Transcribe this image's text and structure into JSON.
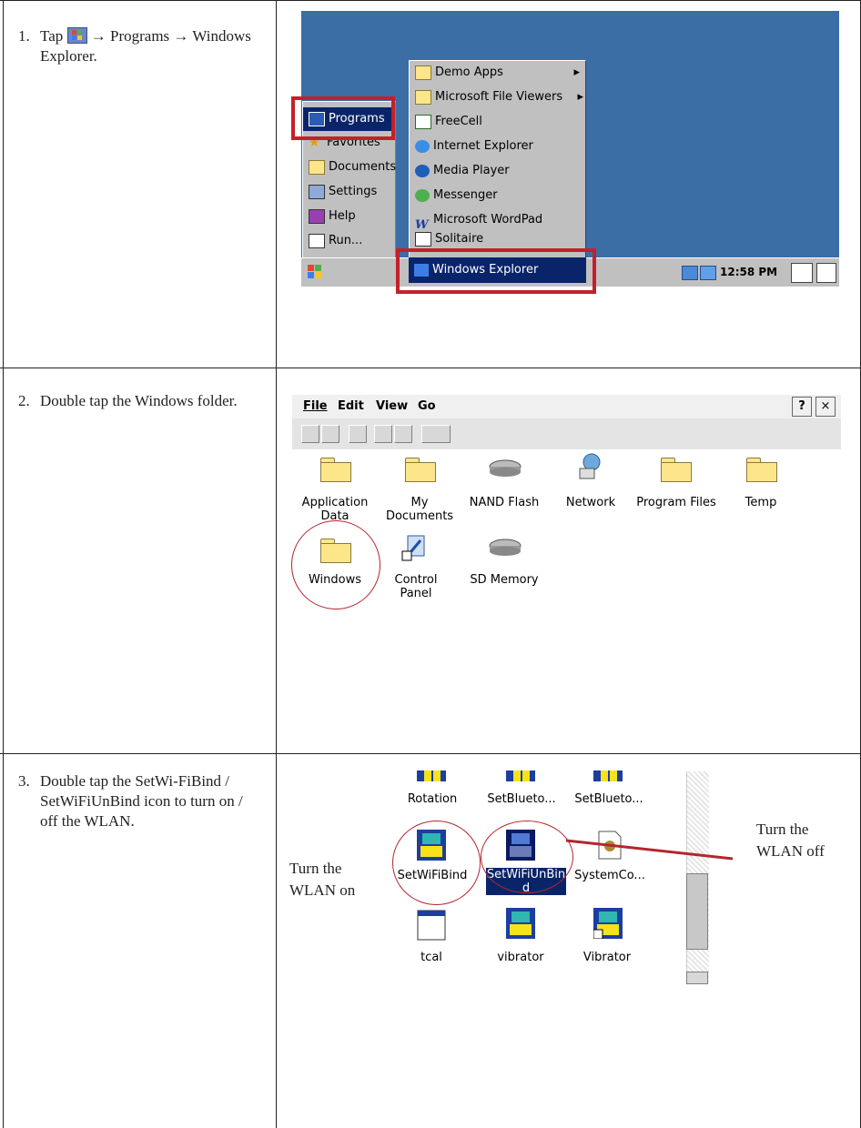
{
  "steps": [
    {
      "num": "1.",
      "text_pre": "Tap",
      "text_post": "→ Programs → Windows Explorer."
    },
    {
      "num": "2.",
      "text": "Double tap the Windows folder."
    },
    {
      "num": "3.",
      "text": "Double tap the SetWi-FiBind / SetWiFiUnBind icon to turn on / off the WLAN."
    }
  ],
  "start_menu": {
    "items": [
      "Programs",
      "Favorites",
      "Documents",
      "Settings",
      "Help",
      "Run..."
    ]
  },
  "programs_menu": {
    "items": [
      "Demo Apps",
      "Microsoft File Viewers",
      "FreeCell",
      "Internet Explorer",
      "Media Player",
      "Messenger",
      "Microsoft WordPad",
      "Solitaire",
      "Windows Explorer"
    ]
  },
  "taskbar": {
    "clock": "12:58 PM"
  },
  "explorer": {
    "menus": [
      "File",
      "Edit",
      "View",
      "Go"
    ],
    "help_label": "?",
    "close_label": "×",
    "items_row1": [
      "Application Data",
      "My Documents",
      "NAND Flash",
      "Network",
      "Program Files",
      "Temp"
    ],
    "items_row2": [
      "Windows",
      "Control Panel",
      "SD Memory"
    ]
  },
  "wlan_folder": {
    "row1": [
      "Rotation",
      "SetBlueto...",
      "SetBlueto..."
    ],
    "row2": [
      "SetWiFiBind",
      "SetWiFiUnBind",
      "SystemCo..."
    ],
    "row3": [
      "tcal",
      "vibrator",
      "Vibrator"
    ]
  },
  "annotations": {
    "on": "Turn the WLAN on",
    "off": "Turn the WLAN off"
  },
  "colors": {
    "highlight": "#c4202a",
    "desktop": "#3a6ea5",
    "selection": "#0a246a"
  }
}
